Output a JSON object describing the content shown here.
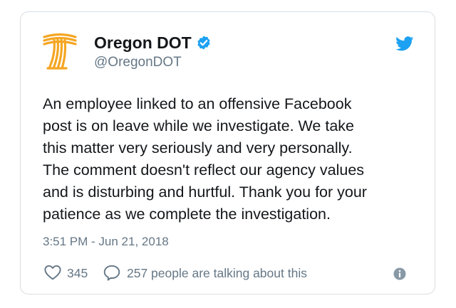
{
  "tweet": {
    "display_name": "Oregon DOT",
    "handle": "@OregonDOT",
    "verified": true,
    "text_lines": [
      "An employee linked to an offensive Facebook",
      "post is on leave while we investigate. We take",
      "this matter very seriously and very personally.",
      "The comment doesn't reflect our agency values",
      "and is disturbing and hurtful. Thank you for your",
      "patience as we complete the investigation."
    ],
    "timestamp": "3:51 PM - Jun 21, 2018",
    "like_count": "345",
    "talking_text": "257 people are talking about this"
  },
  "icons": {
    "avatar": "oregon-dot-logo",
    "verified": "verified-badge-icon",
    "brand": "twitter-bird-icon",
    "like": "heart-icon",
    "reply": "comment-icon",
    "info": "info-icon"
  },
  "colors": {
    "logo_orange": "#f5a623",
    "verified_blue": "#1da1f2",
    "twitter_blue": "#1da1f2",
    "secondary_text": "#657786",
    "primary_text": "#14171a",
    "card_border": "#d9dde1"
  }
}
